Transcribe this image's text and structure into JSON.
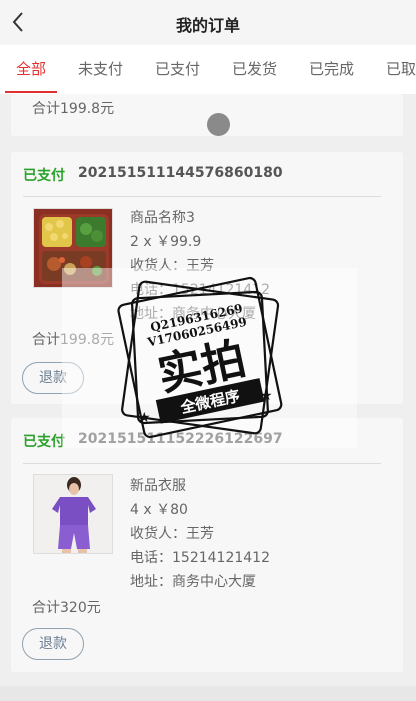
{
  "header": {
    "title": "我的订单"
  },
  "tabs": [
    {
      "label": "全部"
    },
    {
      "label": "未支付"
    },
    {
      "label": "已支付"
    },
    {
      "label": "已发货"
    },
    {
      "label": "已完成"
    },
    {
      "label": "已取"
    }
  ],
  "orders": [
    {
      "total": "合计199.8元"
    },
    {
      "status": "已支付",
      "order_no": "202151511144576860180",
      "product_name": "商品名称3",
      "quantity_price": "2 x ￥99.9",
      "receiver": "收货人：王芳",
      "phone": "电话：15214121412",
      "address": "地址：商务中心大厦",
      "total": "合计199.8元",
      "refund_label": "退款"
    },
    {
      "status": "已支付",
      "order_no": "202151511152226122697",
      "product_name": "新品衣服",
      "quantity_price": "4 x ￥80",
      "receiver": "收货人：王芳",
      "phone": "电话：15214121412",
      "address": "地址：商务中心大厦",
      "total": "合计320元",
      "refund_label": "退款"
    }
  ],
  "watermark": {
    "contact_qq": "Q2196316269",
    "contact_v": "V17060256499",
    "main_text": "实拍",
    "sub_text": "全微程序"
  },
  "colors": {
    "accent": "#e03030",
    "paid": "#2aa12a"
  }
}
